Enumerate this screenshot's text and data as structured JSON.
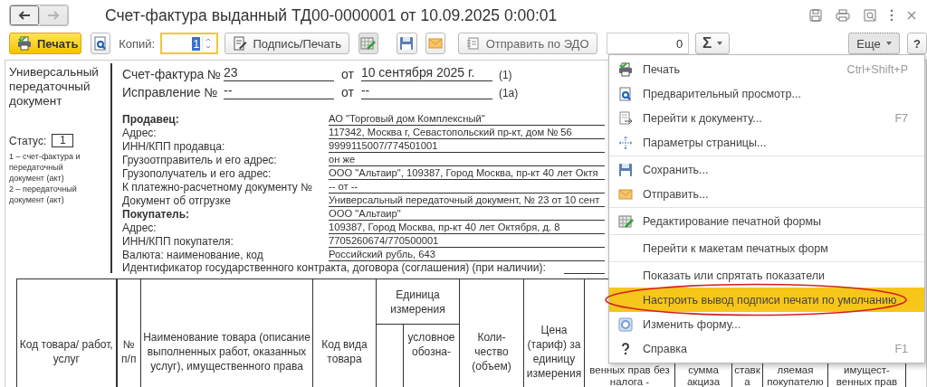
{
  "window": {
    "title": "Счет-фактура выданный ТД00-0000001 от 10.09.2025 0:00:01"
  },
  "nav": {
    "back": {
      "disabled": false
    },
    "forward": {
      "disabled": true
    }
  },
  "toolbar": {
    "print_label": "Печать",
    "copies_label": "Копий:",
    "copies_value": "1",
    "sign_label": "Подпись/Печать",
    "edo_label": "Отправить по ЭДО",
    "sum_value": "0",
    "sum_symbol": "Σ",
    "more_label": "Еще",
    "help_label": "?"
  },
  "document": {
    "form_title": "Универсальный передаточный документ",
    "status_label": "Статус:",
    "status_value": "1",
    "status_notes": [
      "1 – счет-фактура и передаточный документ (акт)",
      "2 – передаточный документ (акт)"
    ],
    "header_rows": [
      {
        "label": "Счет-фактура №",
        "number": "23",
        "date_label": "от",
        "date": "10 сентября 2025 г.",
        "note": "(1)"
      },
      {
        "label": "Исправление №",
        "number": "--",
        "date_label": "от",
        "date": "--",
        "note": "(1а)"
      }
    ],
    "details": [
      {
        "label": "Продавец:",
        "value": "АО \"Торговый дом Комплексный\"",
        "bold": true
      },
      {
        "label": "Адрес:",
        "value": "117342, Москва г, Севастопольский пр-кт, дом № 56",
        "bold": false
      },
      {
        "label": "ИНН/КПП продавца:",
        "value": "9999115007/774501001",
        "bold": false
      },
      {
        "label": "Грузоотправитель и его адрес:",
        "value": "он же",
        "bold": false
      },
      {
        "label": "Грузополучатель и его адрес:",
        "value": "ООО \"Альтаир\", 109387, Город Москва, пр-кт 40 лет Октя",
        "bold": false
      },
      {
        "label": "К платежно-расчетному документу №",
        "value": "-- от --",
        "bold": false
      },
      {
        "label": "Документ об отгрузке",
        "value": "Универсальный передаточный документ, № 23 от 10 сент",
        "bold": false
      },
      {
        "label": "Покупатель:",
        "value": "ООО \"Альтаир\"",
        "bold": true
      },
      {
        "label": "Адрес:",
        "value": "109387, Город Москва, пр-кт 40 лет Октября, д. 8",
        "bold": false
      },
      {
        "label": "ИНН/КПП покупателя:",
        "value": "7705260674/770500001",
        "bold": false
      },
      {
        "label": "Валюта: наименование, код",
        "value": "Российский рубль, 643",
        "bold": false
      }
    ],
    "contract_label": "Идентификатор государственного контракта, договора (соглашения) (при наличии):",
    "table": {
      "columns": [
        {
          "label": "Код товара/ работ, услуг"
        },
        {
          "label": "№ п/п"
        },
        {
          "label": "Наименование товара (описание выполненных работ, оказанных услуг), имущественного права"
        },
        {
          "label": "Код вида товара"
        },
        {
          "label": "Единица измерения",
          "subcolumns": [
            "условное обозна-"
          ]
        },
        {
          "label": "Коли- чество (объем)"
        },
        {
          "label": "Цена (тариф) за единицу измерения"
        },
        {
          "label": "венных прав без налога -"
        },
        {
          "label": "сумма акциза"
        },
        {
          "label": "ставк а"
        },
        {
          "label": "ляемая покупателю"
        },
        {
          "label": "имущест- венных прав"
        }
      ]
    }
  },
  "menu": {
    "items": [
      {
        "label": "Печать",
        "shortcut": "Ctrl+Shift+P",
        "selected": false,
        "separator_after": false
      },
      {
        "label": "Предварительный просмотр...",
        "selected": false,
        "separator_after": false
      },
      {
        "label": "Перейти к документу...",
        "shortcut": "F7",
        "selected": false,
        "separator_after": false
      },
      {
        "label": "Параметры страницы...",
        "selected": false,
        "separator_after": true
      },
      {
        "label": "Сохранить...",
        "selected": false,
        "separator_after": false
      },
      {
        "label": "Отправить...",
        "selected": false,
        "separator_after": true
      },
      {
        "label": "Редактирование печатной формы",
        "selected": false,
        "separator_after": true
      },
      {
        "label": "Перейти к макетам печатных форм",
        "selected": false,
        "separator_after": true
      },
      {
        "label": "Показать или спрятать показатели",
        "selected": false,
        "separator_after": false
      },
      {
        "label": "Настроить вывод подписи печати по умолчанию",
        "selected": true,
        "separator_after": false
      },
      {
        "label": "Изменить форму...",
        "selected": false,
        "separator_after": false
      },
      {
        "label": "Справка",
        "shortcut": "F1",
        "selected": false,
        "separator_after": false
      }
    ]
  }
}
